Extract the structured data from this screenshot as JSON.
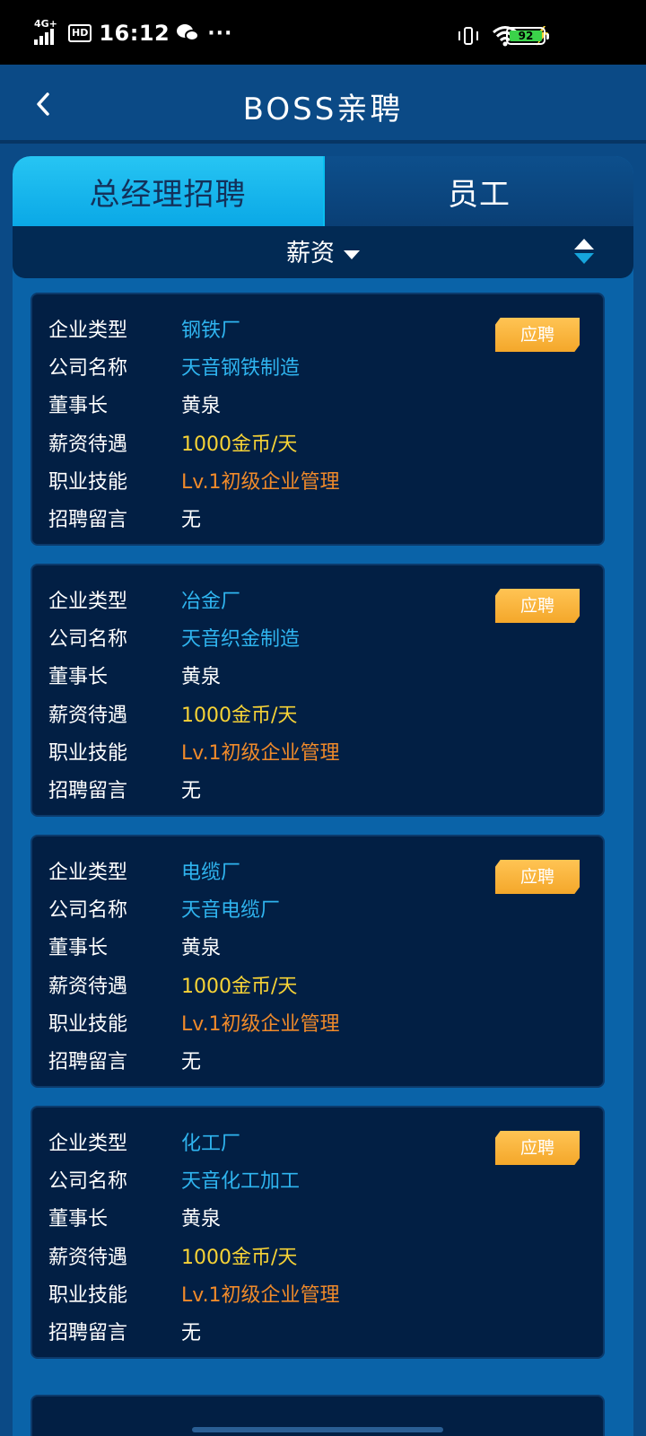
{
  "status_bar": {
    "network": "4G+",
    "hd": "HD",
    "time": "16:12",
    "more": "···",
    "battery": "92"
  },
  "header": {
    "title": "BOSS亲聘"
  },
  "tabs": [
    {
      "label": "总经理招聘",
      "active": true
    },
    {
      "label": "员工",
      "active": false
    }
  ],
  "sort": {
    "label": "薪资"
  },
  "labels": {
    "type": "企业类型",
    "company": "公司名称",
    "chairman": "董事长",
    "salary": "薪资待遇",
    "skill": "职业技能",
    "message": "招聘留言"
  },
  "apply_label": "应聘",
  "cards": [
    {
      "type": "钢铁厂",
      "company": "天音钢铁制造",
      "chairman": "黄泉",
      "salary": "1000金币/天",
      "skill": "Lv.1初级企业管理",
      "message": "无"
    },
    {
      "type": "冶金厂",
      "company": "天音织金制造",
      "chairman": "黄泉",
      "salary": "1000金币/天",
      "skill": "Lv.1初级企业管理",
      "message": "无"
    },
    {
      "type": "电缆厂",
      "company": "天音电缆厂",
      "chairman": "黄泉",
      "salary": "1000金币/天",
      "skill": "Lv.1初级企业管理",
      "message": "无"
    },
    {
      "type": "化工厂",
      "company": "天音化工加工",
      "chairman": "黄泉",
      "salary": "1000金币/天",
      "skill": "Lv.1初级企业管理",
      "message": "无"
    }
  ],
  "colors": {
    "type_value": "#2fb4ef",
    "salary_value": "#f7d336",
    "skill_value": "#f08a2a",
    "apply_button": "#f4a72a",
    "active_tab": "#0aa8e6"
  }
}
